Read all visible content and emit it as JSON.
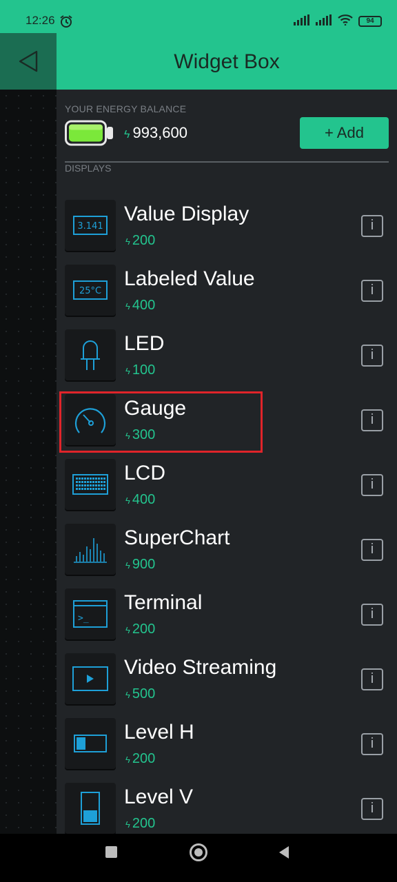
{
  "status_bar": {
    "time": "12:26",
    "battery_level": "94",
    "icons": [
      "alarm-icon",
      "signal-icon",
      "signal-icon",
      "wifi-icon",
      "battery-icon"
    ]
  },
  "header": {
    "title": "Widget Box"
  },
  "energy": {
    "caption": "YOUR ENERGY BALANCE",
    "amount": "993,600",
    "add_label": "+ Add"
  },
  "section": {
    "label": "DISPLAYS"
  },
  "widgets": [
    {
      "name": "Value Display",
      "cost": "200",
      "icon": "value-display-icon",
      "icon_text": "3.141"
    },
    {
      "name": "Labeled Value",
      "cost": "400",
      "icon": "labeled-value-icon",
      "icon_text": "25°C"
    },
    {
      "name": "LED",
      "cost": "100",
      "icon": "led-icon"
    },
    {
      "name": "Gauge",
      "cost": "300",
      "icon": "gauge-icon"
    },
    {
      "name": "LCD",
      "cost": "400",
      "icon": "lcd-icon"
    },
    {
      "name": "SuperChart",
      "cost": "900",
      "icon": "superchart-icon"
    },
    {
      "name": "Terminal",
      "cost": "200",
      "icon": "terminal-icon",
      "icon_text": ">_"
    },
    {
      "name": "Video Streaming",
      "cost": "500",
      "icon": "video-streaming-icon"
    },
    {
      "name": "Level H",
      "cost": "200",
      "icon": "level-h-icon"
    },
    {
      "name": "Level V",
      "cost": "200",
      "icon": "level-v-icon"
    }
  ],
  "info_label": "i",
  "highlighted_widget": "Gauge",
  "colors": {
    "accent": "#23c48e",
    "header_dark": "#1b6d52",
    "panel": "#212427",
    "icon_line": "#1ea0d8",
    "highlight": "#e0242a"
  }
}
